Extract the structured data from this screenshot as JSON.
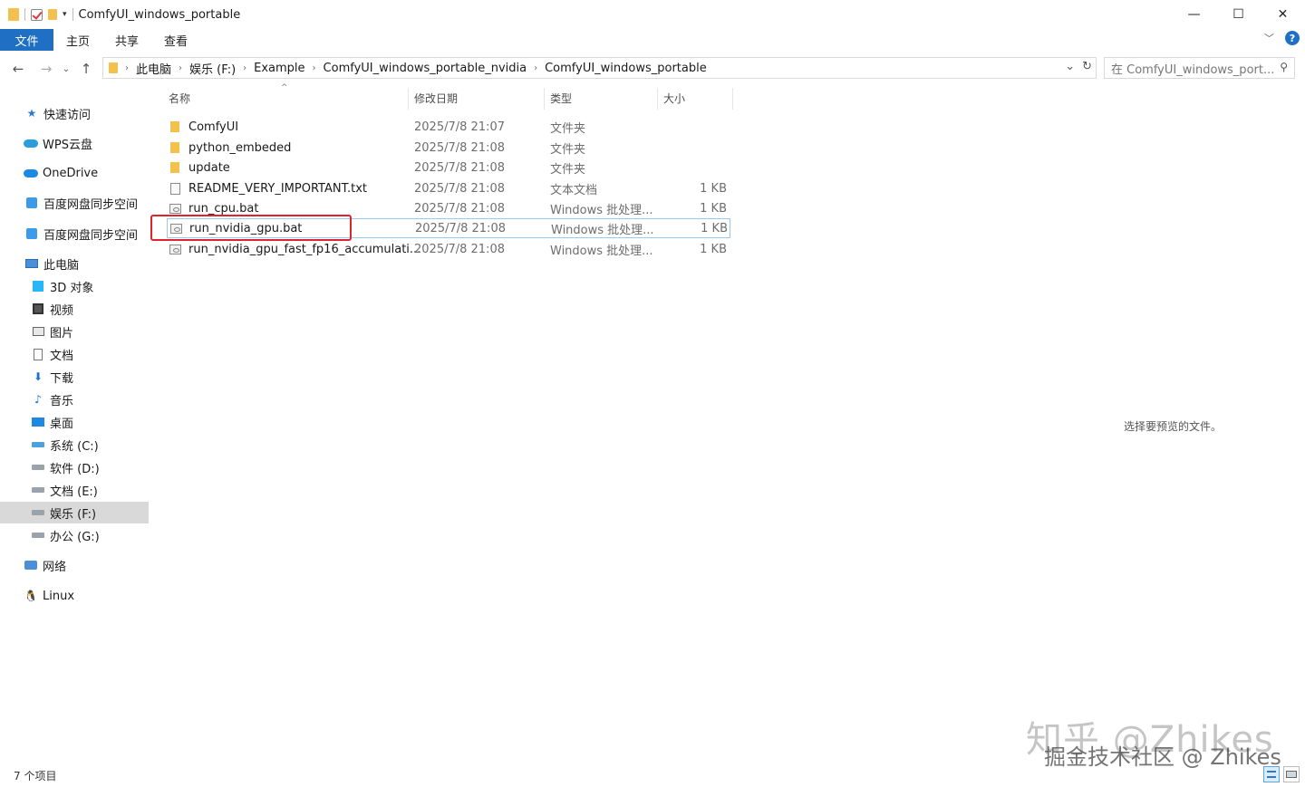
{
  "window": {
    "title": "ComfyUI_windows_portable",
    "minimize": "—",
    "maximize": "☐",
    "close": "✕"
  },
  "ribbon": {
    "tabs": [
      "文件",
      "主页",
      "共享",
      "查看"
    ],
    "help": "?"
  },
  "address": {
    "crumbs": [
      "此电脑",
      "娱乐 (F:)",
      "Example",
      "ComfyUI_windows_portable_nvidia",
      "ComfyUI_windows_portable"
    ],
    "search_placeholder": "在 ComfyUI_windows_port..."
  },
  "sidebar": {
    "items": [
      {
        "label": "快速访问",
        "icon": "star-icon"
      },
      {
        "label": "WPS云盘",
        "icon": "wps-cloud-icon"
      },
      {
        "label": "OneDrive",
        "icon": "onedrive-cloud-icon"
      },
      {
        "label": "百度网盘同步空间",
        "icon": "baidu-netdisk-icon"
      },
      {
        "label": "百度网盘同步空间",
        "icon": "baidu-netdisk-icon"
      },
      {
        "label": "此电脑",
        "icon": "computer-icon"
      },
      {
        "label": "3D 对象",
        "icon": "3d-objects-icon"
      },
      {
        "label": "视频",
        "icon": "video-icon"
      },
      {
        "label": "图片",
        "icon": "pictures-icon"
      },
      {
        "label": "文档",
        "icon": "documents-icon"
      },
      {
        "label": "下载",
        "icon": "download-icon"
      },
      {
        "label": "音乐",
        "icon": "music-icon"
      },
      {
        "label": "桌面",
        "icon": "desktop-icon"
      },
      {
        "label": "系统 (C:)",
        "icon": "system-drive-icon"
      },
      {
        "label": "软件 (D:)",
        "icon": "drive-icon"
      },
      {
        "label": "文档 (E:)",
        "icon": "drive-icon"
      },
      {
        "label": "娱乐 (F:)",
        "icon": "drive-icon",
        "selected": true
      },
      {
        "label": "办公 (G:)",
        "icon": "drive-icon"
      },
      {
        "label": "网络",
        "icon": "network-icon"
      },
      {
        "label": "Linux",
        "icon": "linux-icon"
      }
    ]
  },
  "columns": {
    "name": "名称",
    "date": "修改日期",
    "type": "类型",
    "size": "大小"
  },
  "files": [
    {
      "name": "ComfyUI",
      "date": "2025/7/8 21:07",
      "type": "文件夹",
      "size": "",
      "icon": "folder-icon"
    },
    {
      "name": "python_embeded",
      "date": "2025/7/8 21:08",
      "type": "文件夹",
      "size": "",
      "icon": "folder-icon"
    },
    {
      "name": "update",
      "date": "2025/7/8 21:08",
      "type": "文件夹",
      "size": "",
      "icon": "folder-icon"
    },
    {
      "name": "README_VERY_IMPORTANT.txt",
      "date": "2025/7/8 21:08",
      "type": "文本文档",
      "size": "1 KB",
      "icon": "text-file-icon"
    },
    {
      "name": "run_cpu.bat",
      "date": "2025/7/8 21:08",
      "type": "Windows 批处理...",
      "size": "1 KB",
      "icon": "batch-file-icon"
    },
    {
      "name": "run_nvidia_gpu.bat",
      "date": "2025/7/8 21:08",
      "type": "Windows 批处理...",
      "size": "1 KB",
      "icon": "batch-file-icon",
      "selected": true
    },
    {
      "name": "run_nvidia_gpu_fast_fp16_accumulati...",
      "date": "2025/7/8 21:08",
      "type": "Windows 批处理...",
      "size": "1 KB",
      "icon": "batch-file-icon"
    }
  ],
  "preview": {
    "message": "选择要预览的文件。"
  },
  "status": {
    "count": "7 个项目"
  },
  "watermark": {
    "line1": "知乎 @Zhikes",
    "line2": "掘金技术社区 @ Zhikes"
  },
  "colors": {
    "file_tab": "#1f6fc5",
    "highlight": "#e0242b",
    "selection_border": "#99c9ef"
  }
}
